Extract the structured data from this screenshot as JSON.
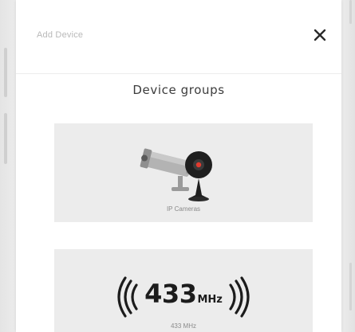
{
  "modal": {
    "title": "Add Device",
    "close_symbol": "✕"
  },
  "section": {
    "heading": "Device groups"
  },
  "device_groups": [
    {
      "label": "IP Cameras",
      "icon": "ip-camera-icon"
    },
    {
      "badge_number": "433",
      "badge_unit": "MHz",
      "label": "433 MHz",
      "icon": "radio-433mhz-icon"
    }
  ],
  "colors": {
    "modal_background": "#ffffff",
    "card_background": "#ececec",
    "heading_text": "#3c3c3c",
    "muted_text": "#b9b9b9",
    "icon_dark": "#1c1c1c",
    "camera_grey": "#a7a7a7"
  }
}
